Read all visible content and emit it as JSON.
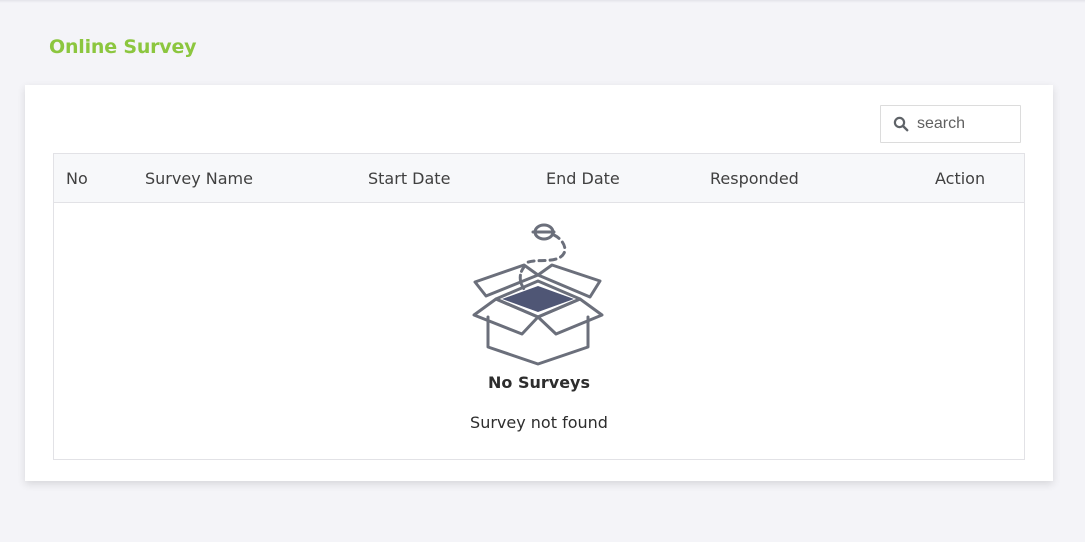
{
  "page": {
    "title": "Online Survey"
  },
  "search": {
    "placeholder": "search",
    "value": ""
  },
  "table": {
    "columns": [
      "No",
      "Survey Name",
      "Start Date",
      "End Date",
      "Responded",
      "Action"
    ],
    "rows": []
  },
  "empty_state": {
    "icon": "open-box-icon",
    "title": "No Surveys",
    "message": "Survey not found"
  },
  "colors": {
    "accent": "#8cc63f",
    "background": "#f4f4f8",
    "icon_stroke": "#6b6f7b",
    "icon_fill": "#4f5675"
  }
}
